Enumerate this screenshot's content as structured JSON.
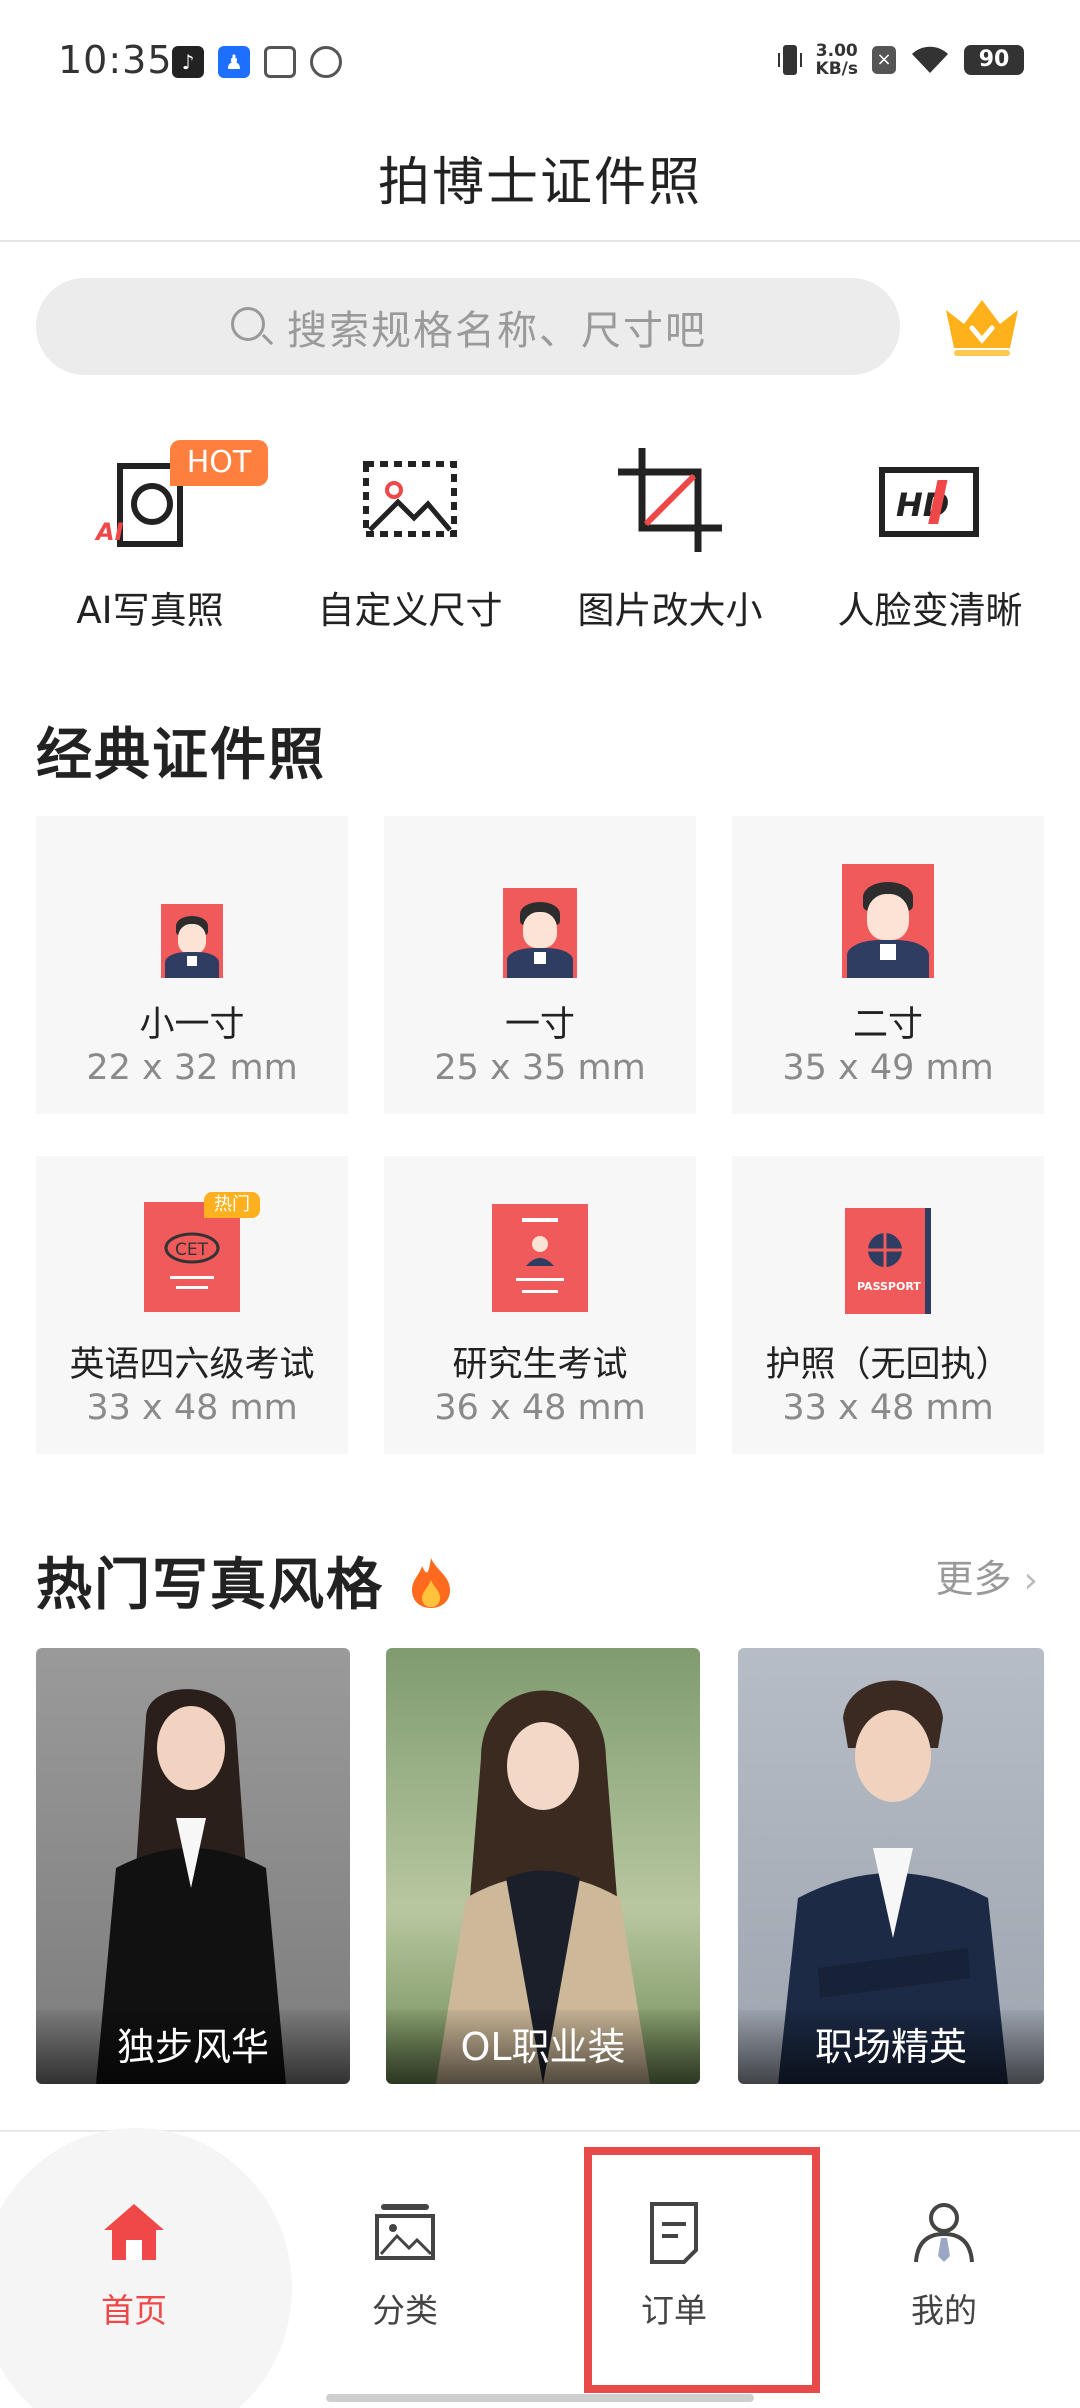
{
  "status_bar": {
    "time": "10:35",
    "net_speed_value": "3.00",
    "net_speed_unit": "KB/s",
    "battery": "90"
  },
  "header": {
    "title": "拍博士证件照"
  },
  "search": {
    "placeholder": "搜索规格名称、尺寸吧"
  },
  "tools": [
    {
      "label": "AI写真照",
      "badge": "HOT",
      "icon": "ai-camera-icon"
    },
    {
      "label": "自定义尺寸",
      "icon": "custom-size-icon"
    },
    {
      "label": "图片改大小",
      "icon": "crop-icon"
    },
    {
      "label": "人脸变清晰",
      "icon": "hd-icon"
    }
  ],
  "ai_icon_text": "AI",
  "hd_icon_text": "HD",
  "classic": {
    "title": "经典证件照",
    "items": [
      {
        "title": "小一寸",
        "size": "22 x 32 mm"
      },
      {
        "title": "一寸",
        "size": "25 x 35 mm"
      },
      {
        "title": "二寸",
        "size": "35 x 49 mm"
      },
      {
        "title": "英语四六级考试",
        "size": "33 x 48 mm",
        "badge": "热门",
        "icon_text": "CET"
      },
      {
        "title": "研究生考试",
        "size": "36 x 48 mm"
      },
      {
        "title": "护照（无回执）",
        "size": "33 x 48 mm",
        "icon_text": "PASSPORT"
      }
    ]
  },
  "styles": {
    "title": "热门写真风格",
    "more": "更多",
    "items": [
      {
        "label": "独步风华"
      },
      {
        "label": "OL职业装"
      },
      {
        "label": "职场精英"
      }
    ]
  },
  "nav": {
    "items": [
      {
        "label": "首页",
        "active": true
      },
      {
        "label": "分类"
      },
      {
        "label": "订单"
      },
      {
        "label": "我的"
      }
    ]
  },
  "colors": {
    "accent": "#f04848",
    "hot_badge": "#ff7f3f",
    "crown": "#ffb11b",
    "portrait_bg": "#f15a5a"
  }
}
